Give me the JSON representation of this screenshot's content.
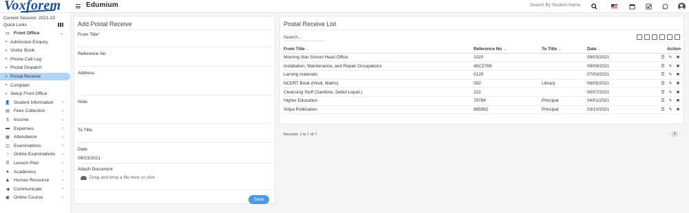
{
  "app": {
    "logo": "Voxforem",
    "brand": "Edumium"
  },
  "topbar": {
    "search_placeholder": "Search By Student Name",
    "icons": [
      "search-icon",
      "us-flag-icon",
      "calendar-icon",
      "checkbox-icon",
      "whatsapp-icon",
      "avatar"
    ]
  },
  "sidebar": {
    "session": "Current Session: 2021-22",
    "quick_links": "Quick Links",
    "items": [
      {
        "label": "Front Office",
        "icon": "monitor",
        "bold": true,
        "chev": "⌄"
      },
      {
        "label": "Admission Enquiry",
        "sub": true
      },
      {
        "label": "Visitor Book",
        "sub": true
      },
      {
        "label": "Phone Call Log",
        "sub": true
      },
      {
        "label": "Postal Dispatch",
        "sub": true
      },
      {
        "label": "Postal Receive",
        "sub": true,
        "active": true
      },
      {
        "label": "Complain",
        "sub": true
      },
      {
        "label": "Setup Front Office",
        "sub": true
      },
      {
        "label": "Student Information",
        "icon": "user",
        "chev": "‹"
      },
      {
        "label": "Fees Collection",
        "icon": "money",
        "chev": "‹"
      },
      {
        "label": "Income",
        "icon": "dollar",
        "chev": "‹"
      },
      {
        "label": "Expenses",
        "icon": "card",
        "chev": "‹"
      },
      {
        "label": "Attendance",
        "icon": "calendar",
        "chev": "‹"
      },
      {
        "label": "Examinations",
        "icon": "map",
        "chev": "‹"
      },
      {
        "label": "Online Examinations",
        "icon": "rss",
        "chev": "‹"
      },
      {
        "label": "Lesson Plan",
        "icon": "list",
        "chev": "‹"
      },
      {
        "label": "Academics",
        "icon": "cap",
        "chev": "‹"
      },
      {
        "label": "Human Resource",
        "icon": "sitemap",
        "chev": "‹"
      },
      {
        "label": "Communicate",
        "icon": "bullhorn",
        "chev": "‹"
      },
      {
        "label": "Online Course",
        "icon": "file",
        "chev": "‹"
      }
    ]
  },
  "form": {
    "title": "Add Postal Receive",
    "from_title_label": "From Title",
    "required_mark": "*",
    "reference_label": "Reference No",
    "address_label": "Address",
    "note_label": "Note",
    "to_title_label": "To Title",
    "date_label": "Date",
    "date_value": "09/23/2021",
    "attach_label": "Attach Document",
    "drop_text": "Drag and drop a file here or click",
    "save_label": "Save"
  },
  "list": {
    "title": "Postal Receive List",
    "search_placeholder": "Search...",
    "columns": [
      "From Title",
      "Reference No",
      "To Title",
      "Date",
      "Action"
    ],
    "rows": [
      {
        "from": "Morning Star School Head Office.",
        "ref": "1020",
        "to": "",
        "date": "09/03/2021"
      },
      {
        "from": "Installation, Maintenance, and Repair Occupations",
        "ref": "45CZ769",
        "to": "",
        "date": "09/09/2021"
      },
      {
        "from": "Larning materials",
        "ref": "0120",
        "to": "",
        "date": "07/03/2021"
      },
      {
        "from": "NCERT Book (Hindi, Maths)",
        "ref": "092",
        "to": "Library",
        "date": "06/05/2021"
      },
      {
        "from": "Cleansing Stuff (Sanitizer, Dettol Liquid.)",
        "ref": "222",
        "to": "",
        "date": "05/07/2021"
      },
      {
        "from": "Higher Education",
        "ref": "78784",
        "to": "Principal",
        "date": "04/01/2021"
      },
      {
        "from": "Vidya Publication",
        "ref": "885962",
        "to": "Principal",
        "date": "03/10/2021"
      }
    ],
    "records_text": "Records: 1 to 7 of 7",
    "page": "1",
    "prev": "‹",
    "next": "›"
  },
  "colors": {
    "accent": "#4a9ae6",
    "active_bg": "#b3d4f7",
    "logo": "#1d4e96"
  }
}
